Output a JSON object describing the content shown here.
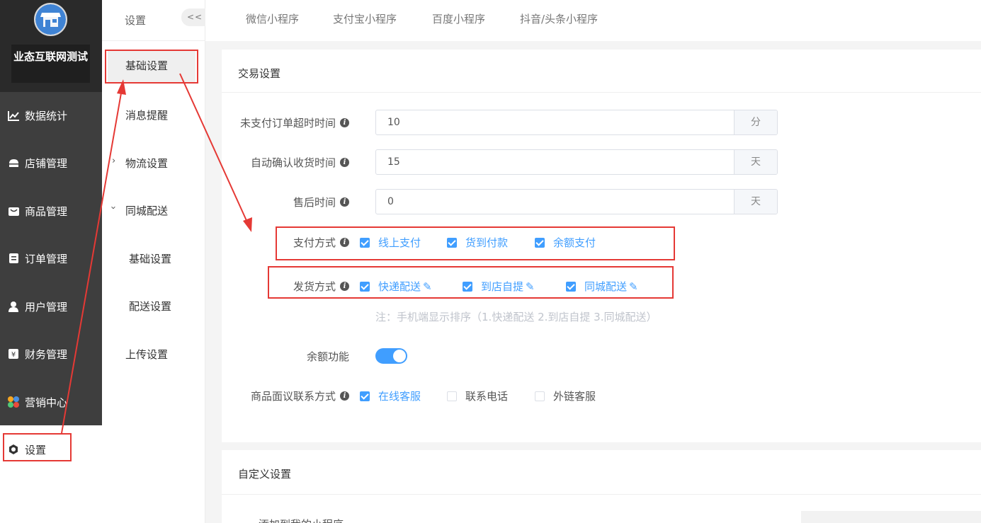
{
  "sidebar": {
    "shop_name": "业态互联网测试",
    "items": [
      {
        "label": "数据统计",
        "icon": "line-chart-icon"
      },
      {
        "label": "店铺管理",
        "icon": "store-icon"
      },
      {
        "label": "商品管理",
        "icon": "product-icon"
      },
      {
        "label": "订单管理",
        "icon": "order-icon"
      },
      {
        "label": "用户管理",
        "icon": "user-icon"
      },
      {
        "label": "财务管理",
        "icon": "finance-icon"
      },
      {
        "label": "营销中心",
        "icon": "marketing-icon"
      },
      {
        "label": "设置",
        "icon": "settings-icon"
      }
    ],
    "active": "设置"
  },
  "subnav": {
    "title": "设置",
    "collapse_label": "<<",
    "items": {
      "basic": "基础设置",
      "message": "消息提醒",
      "logistics": "物流设置",
      "city_delivery": "同城配送",
      "city_basic": "基础设置",
      "city_config": "配送设置",
      "upload": "上传设置"
    }
  },
  "topbar": {
    "tabs": [
      "微信小程序",
      "支付宝小程序",
      "百度小程序",
      "抖音/头条小程序"
    ]
  },
  "trade": {
    "title": "交易设置",
    "unpaid_timeout": {
      "label": "未支付订单超时时间",
      "value": "10",
      "unit": "分"
    },
    "auto_confirm": {
      "label": "自动确认收货时间",
      "value": "15",
      "unit": "天"
    },
    "after_sale": {
      "label": "售后时间",
      "value": "0",
      "unit": "天"
    },
    "payment": {
      "label": "支付方式",
      "options": [
        {
          "label": "线上支付",
          "checked": true
        },
        {
          "label": "货到付款",
          "checked": true
        },
        {
          "label": "余额支付",
          "checked": true
        }
      ]
    },
    "shipping": {
      "label": "发货方式",
      "options": [
        {
          "label": "快递配送",
          "checked": true
        },
        {
          "label": "到店自提",
          "checked": true
        },
        {
          "label": "同城配送",
          "checked": true
        }
      ],
      "note": "注：手机端显示排序（1.快递配送 2.到店自提 3.同城配送）"
    },
    "balance": {
      "label": "余额功能",
      "enabled": true
    },
    "contact": {
      "label": "商品面议联系方式",
      "options": [
        {
          "label": "在线客服",
          "checked": true
        },
        {
          "label": "联系电话",
          "checked": false
        },
        {
          "label": "外链客服",
          "checked": false
        }
      ]
    }
  },
  "custom": {
    "title": "自定义设置",
    "add_miniprogram_label": "添加到我的小程序"
  },
  "colors": {
    "accent": "#409eff",
    "annotation": "#e53935",
    "sidebar_bg": "#3e3e3e"
  }
}
